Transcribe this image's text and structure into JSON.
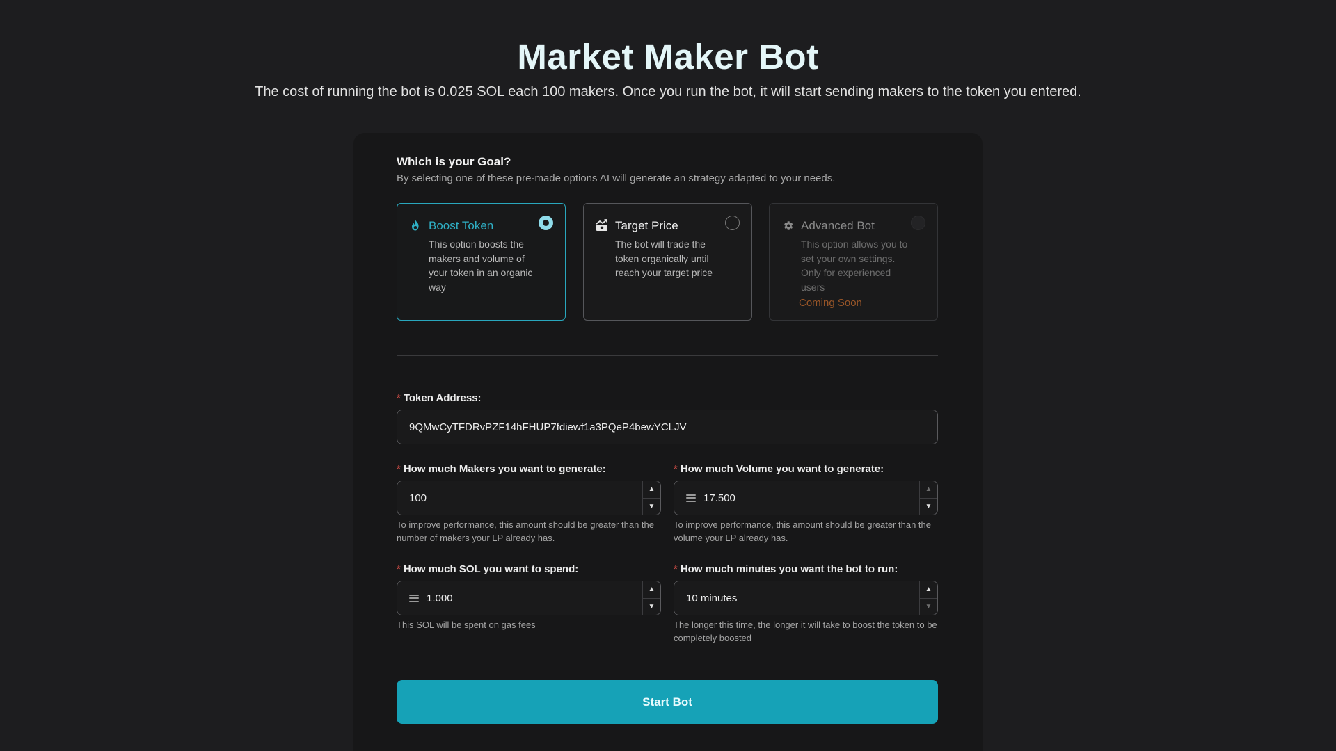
{
  "header": {
    "title": "Market Maker Bot",
    "subtitle": "The cost of running the bot is 0.025 SOL each 100 makers. Once you run the bot, it will start sending makers to the token you entered."
  },
  "goal": {
    "title": "Which is your Goal?",
    "description": "By selecting one of these pre-made options AI will generate an strategy adapted to your needs.",
    "options": [
      {
        "label": "Boost Token",
        "text": "This option boosts the makers and volume of your token in an organic way",
        "icon": "flame-icon",
        "selected": true
      },
      {
        "label": "Target Price",
        "text": "The bot will trade the token organically until reach your target price",
        "icon": "chart-icon",
        "selected": false
      },
      {
        "label": "Advanced Bot",
        "text": "This option allows you to set your own settings. Only for experienced users",
        "icon": "gear-icon",
        "selected": false,
        "badge": "Coming Soon",
        "disabled": true
      }
    ]
  },
  "form": {
    "required_mark": "*",
    "token_address": {
      "label": "Token Address:",
      "value": "9QMwCyTFDRvPZF14hFHUP7fdiewf1a3PQeP4bewYCLJV"
    },
    "makers": {
      "label": "How much Makers you want to generate:",
      "value": "100",
      "help": "To improve performance, this amount should be greater than the number of makers your LP already has."
    },
    "volume": {
      "label": "How much Volume you want to generate:",
      "value": "17.500",
      "icon": "sol-icon",
      "help": "To improve performance, this amount should be greater than the volume your LP already has."
    },
    "sol": {
      "label": "How much SOL you want to spend:",
      "value": "1.000",
      "icon": "sol-icon",
      "help": "This SOL will be spent on gas fees"
    },
    "minutes": {
      "label": "How much minutes you want the bot to run:",
      "value": "10 minutes",
      "help": "The longer this time, the longer it will take to boost the token to be completely boosted"
    },
    "stepper": {
      "up": "▲",
      "down": "▼"
    }
  },
  "actions": {
    "start_label": "Start Bot"
  },
  "colors": {
    "accent": "#16a2b7",
    "selected_border": "#29a7bd",
    "required": "#e0524a",
    "coming_soon": "#9a5628",
    "background": "#1d1d1f",
    "card": "#171718"
  }
}
